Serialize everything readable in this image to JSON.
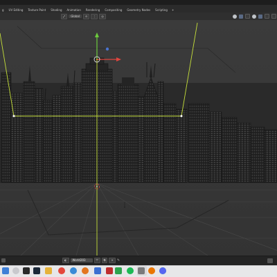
{
  "workspace": {
    "tabs": [
      "g",
      "UV Editing",
      "Texture Paint",
      "Shading",
      "Animation",
      "Rendering",
      "Compositing",
      "Geometry Nodes",
      "Scripting"
    ],
    "add_tab": "+"
  },
  "viewport_header": {
    "orientation": "Global",
    "orientation_icon": "transform-orientation-icon",
    "pivot_icon": "pivot-point-icon",
    "snap_icon": "snap-icon",
    "proportional_icon": "proportional-editing-icon"
  },
  "world_field": {
    "name": "World203",
    "icon": "world-icon",
    "fake_user_icon": "shield-icon",
    "unlink_icon": "x-icon",
    "copy_icon": "duplicate-icon",
    "browse_icon": "chevron-down-icon"
  },
  "viewport": {
    "accent_yellow": "#c6e03a",
    "gizmo_green": "#6ccb3d",
    "gizmo_red": "#e0463f",
    "gizmo_blue": "#4a74d0"
  },
  "taskbar": {
    "apps": [
      "windows-start-icon",
      "search-icon",
      "task-view-icon",
      "steam-icon",
      "file-explorer-icon",
      "chrome-icon",
      "edge-icon",
      "firefox-icon",
      "store-icon",
      "media-icon",
      "green-app-icon",
      "spotify-icon",
      "app-icon",
      "blender-icon",
      "whatsapp-icon",
      "blender-icon",
      "discord-icon"
    ]
  }
}
